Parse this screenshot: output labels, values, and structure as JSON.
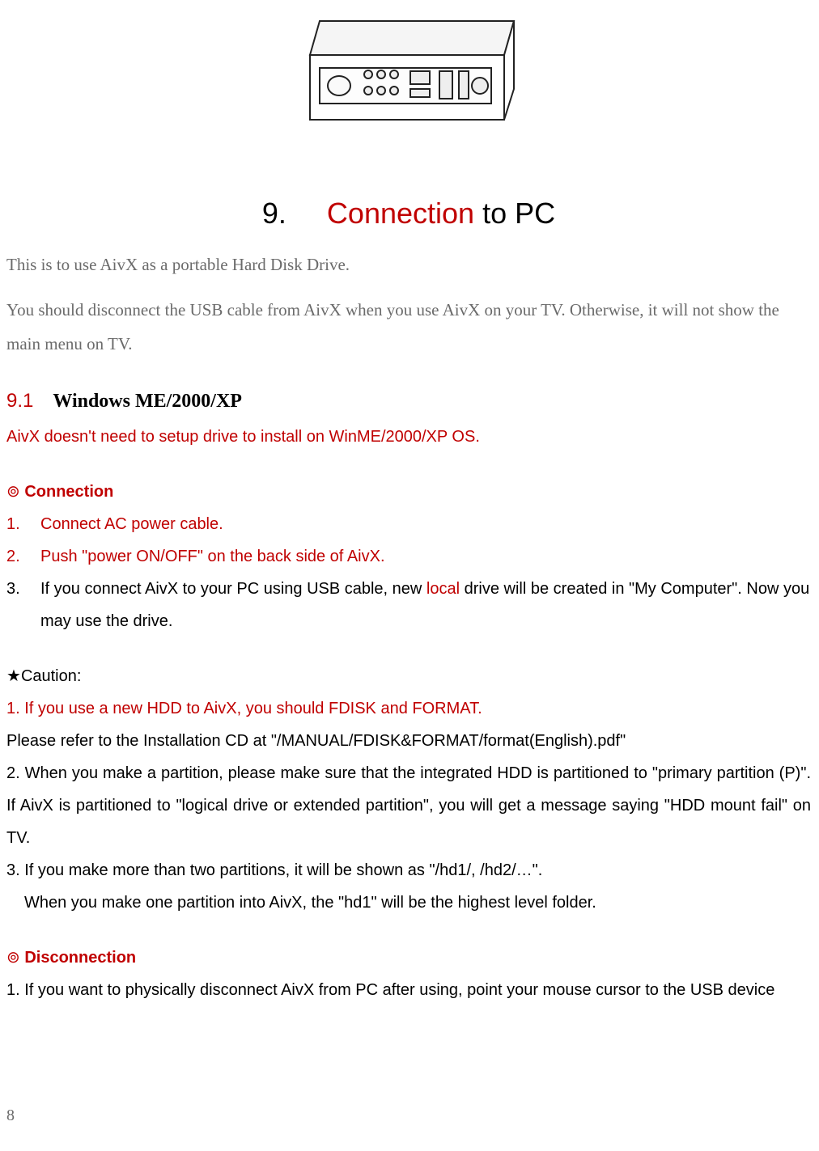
{
  "chapter": {
    "num": "9.",
    "accent": "Connection",
    "rest": " to PC"
  },
  "intro1": "This is to use AivX as a portable Hard Disk Drive.",
  "intro2": "You should disconnect the USB cable from AivX when you use AivX on your TV. Otherwise, it will not show the main menu on TV.",
  "section": {
    "num": "9.1",
    "title": "Windows ME/2000/XP"
  },
  "section_note": "AivX doesn't need to setup drive to install on WinME/2000/XP OS.",
  "conn": {
    "bullet": "⊚",
    "heading": "Connection",
    "items": [
      {
        "n": "1.",
        "text": "Connect   AC power cable.",
        "red": true
      },
      {
        "n": "2.",
        "text": "Push \"power ON/OFF\" on the back side of AivX.",
        "red": true
      },
      {
        "n": "3.",
        "pre": "If you connect AivX to your PC using USB cable, new ",
        "mid": "local",
        "post": " drive will be created in \"My Computer\". Now you may use the drive.",
        "red": false
      }
    ]
  },
  "caution": {
    "star": "★",
    "label": "Caution:",
    "c1": "1. If you use a new HDD to AivX, you should FDISK and FORMAT.",
    "c1b": "Please refer to the Installation CD at \"/MANUAL/FDISK&FORMAT/format(English).pdf\"",
    "c2": "2. When you make a partition, please make sure that the integrated HDD is partitioned to \"primary partition (P)\". If AivX is partitioned to \"logical drive or extended partition\", you will get a message saying \"HDD mount fail\" on TV.",
    "c3a": "3. If you make more than two partitions, it will be shown as \"/hd1/, /hd2/…\".",
    "c3b": "When you make one partition into AivX, the \"hd1\" will be the highest level folder."
  },
  "disc": {
    "bullet": "⊚",
    "heading": "Disconnection",
    "d1": "1. If you want to physically disconnect AivX from PC after using, point your mouse cursor to the USB device"
  },
  "page_number": "8"
}
